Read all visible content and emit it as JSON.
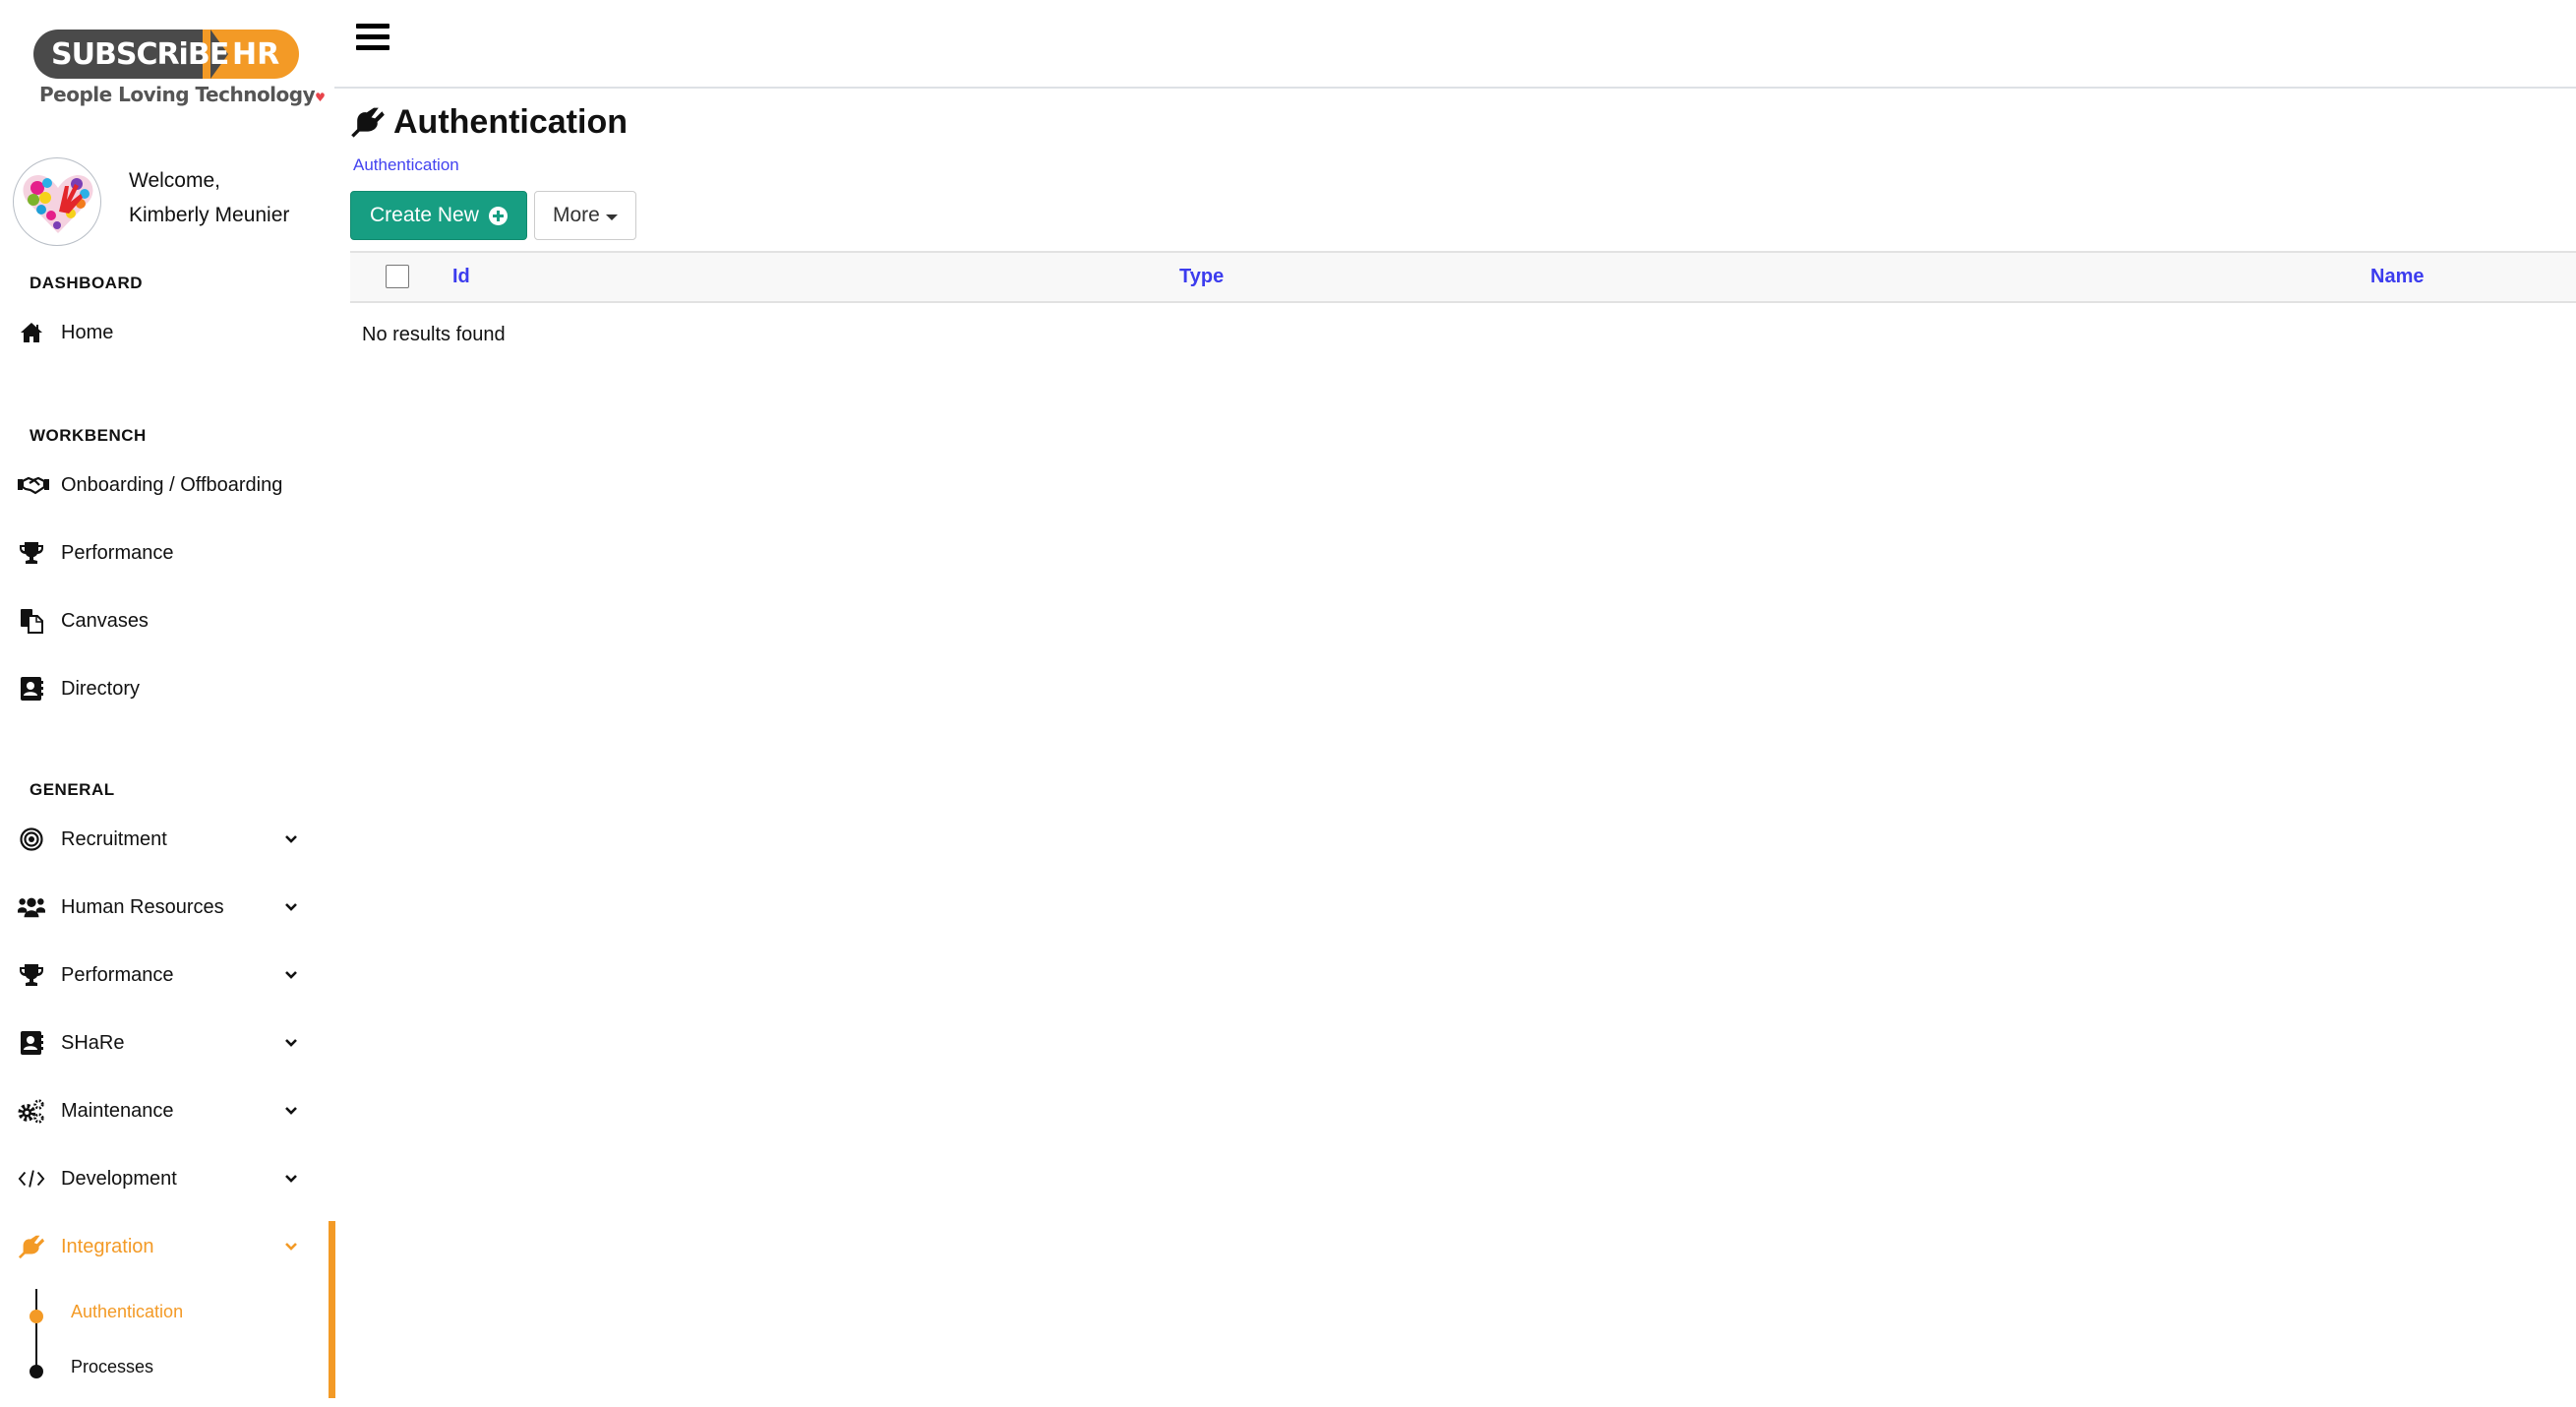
{
  "brand": {
    "logo_left": "SUBSCRiBE",
    "logo_right": "HR",
    "tagline": "People Loving Technology",
    "primary_color": "#179e82",
    "accent_color": "#f39a26",
    "link_color": "#4343f0"
  },
  "profile": {
    "greeting": "Welcome,",
    "user_name": "Kimberly Meunier",
    "avatar_icon": "heart-hands-avatar"
  },
  "sidebar": {
    "sections": [
      {
        "title": "DASHBOARD",
        "items": [
          {
            "label": "Home",
            "icon": "home-icon",
            "expandable": false
          }
        ]
      },
      {
        "title": "WORKBENCH",
        "items": [
          {
            "label": "Onboarding / Offboarding",
            "icon": "handshake-icon",
            "expandable": false
          },
          {
            "label": "Performance",
            "icon": "trophy-icon",
            "expandable": false
          },
          {
            "label": "Canvases",
            "icon": "copy-icon",
            "expandable": false
          },
          {
            "label": "Directory",
            "icon": "address-book-icon",
            "expandable": false
          }
        ]
      },
      {
        "title": "GENERAL",
        "items": [
          {
            "label": "Recruitment",
            "icon": "target-icon",
            "expandable": true
          },
          {
            "label": "Human Resources",
            "icon": "users-icon",
            "expandable": true
          },
          {
            "label": "Performance",
            "icon": "trophy-icon",
            "expandable": true
          },
          {
            "label": "SHaRe",
            "icon": "address-book-icon",
            "expandable": true
          },
          {
            "label": "Maintenance",
            "icon": "gears-icon",
            "expandable": true
          },
          {
            "label": "Development",
            "icon": "code-icon",
            "expandable": true
          },
          {
            "label": "Integration",
            "icon": "plug-icon",
            "expandable": true,
            "active": true,
            "children": [
              {
                "label": "Authentication",
                "active": true
              },
              {
                "label": "Processes",
                "active": false
              }
            ]
          }
        ]
      }
    ]
  },
  "header": {
    "menu_icon": "hamburger-icon"
  },
  "main": {
    "title": "Authentication",
    "title_icon": "plug-icon",
    "breadcrumb": "Authentication",
    "buttons": {
      "create_label": "Create New",
      "more_label": "More"
    },
    "table": {
      "columns": [
        "Id",
        "Type",
        "Name"
      ],
      "rows": [],
      "empty_message": "No results found"
    }
  }
}
